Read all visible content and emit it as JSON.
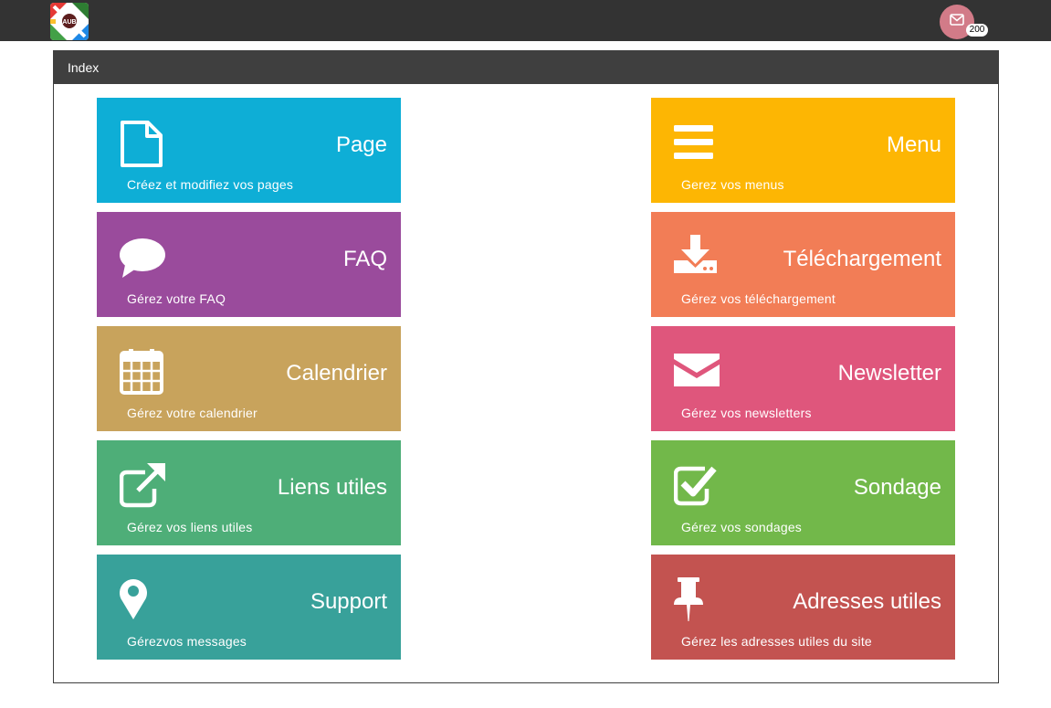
{
  "header": {
    "logo_text": "AUB",
    "mail_count": "200"
  },
  "panel": {
    "title": "Index"
  },
  "tiles": [
    {
      "title": "Page",
      "description": "Créez et modifiez vos pages",
      "color": "#0eaed6",
      "icon": "file-icon"
    },
    {
      "title": "Menu",
      "description": "Gerez vos menus",
      "color": "#fdb603",
      "icon": "bars-icon"
    },
    {
      "title": "FAQ",
      "description": "Gérez votre FAQ",
      "color": "#9a4b9c",
      "icon": "comment-icon"
    },
    {
      "title": "Téléchargement",
      "description": "Gérez vos téléchargement",
      "color": "#f27d56",
      "icon": "download-icon"
    },
    {
      "title": "Calendrier",
      "description": "Gérez votre calendrier",
      "color": "#c8a35c",
      "icon": "calendar-icon"
    },
    {
      "title": "Newsletter",
      "description": "Gérez vos newsletters",
      "color": "#df567c",
      "icon": "envelope-icon"
    },
    {
      "title": "Liens utiles",
      "description": "Gérez vos liens utiles",
      "color": "#4eae78",
      "icon": "external-link-icon"
    },
    {
      "title": "Sondage",
      "description": "Gérez vos sondages",
      "color": "#72b84a",
      "icon": "check-square-icon"
    },
    {
      "title": "Support",
      "description": "Gérezvos messages",
      "color": "#38a19a",
      "icon": "map-marker-icon"
    },
    {
      "title": "Adresses utiles",
      "description": "Gérez les adresses utiles du site",
      "color": "#c35350",
      "icon": "thumbtack-icon"
    }
  ]
}
